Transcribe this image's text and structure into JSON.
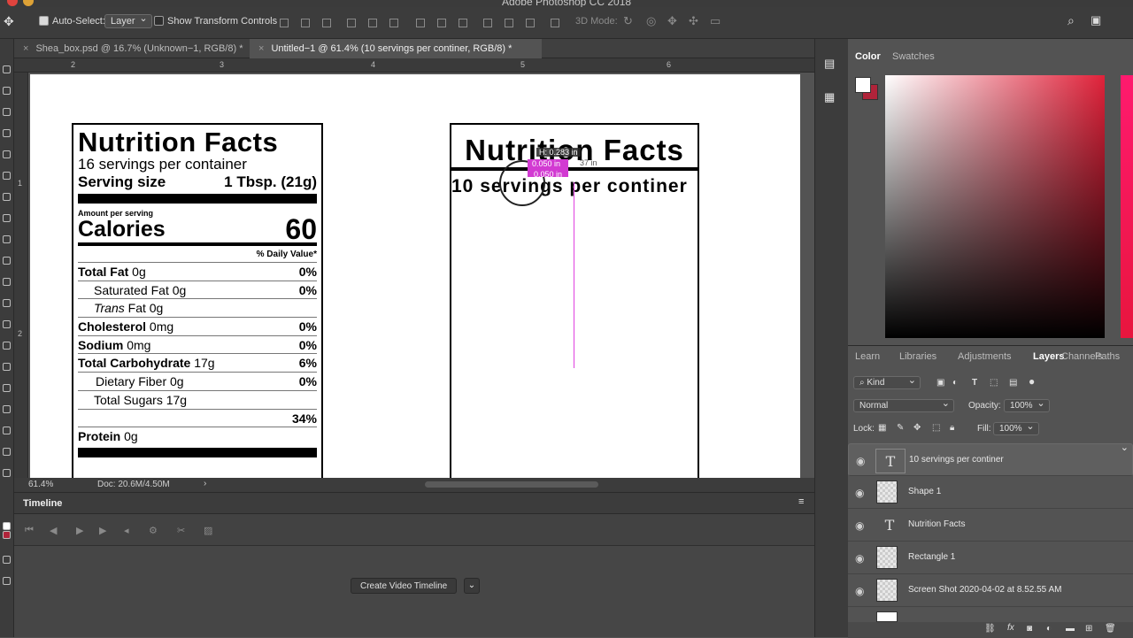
{
  "app": {
    "title": "Adobe Photoshop CC 2018"
  },
  "options_bar": {
    "auto_select_label": "Auto-Select:",
    "auto_select_value": "Layer",
    "transform_label": "Show Transform Controls",
    "mode_label": "3D Mode:"
  },
  "doc_tabs": [
    {
      "label": "Shea_box.psd @ 16.7% (Unknown−1, RGB/8) *"
    },
    {
      "label": "Untitled−1 @ 61.4% (10 servings per continer, RGB/8) *"
    }
  ],
  "rulers": {
    "top": [
      "2",
      "3",
      "4",
      "5",
      "6"
    ],
    "left": [
      "1",
      "2"
    ]
  },
  "nutrition_left": {
    "title": "Nutrition Facts",
    "servings": "16 servings per container",
    "serving_size_label": "Serving size",
    "serving_size_value": "1 Tbsp. (21g)",
    "amount_per_serving": "Amount per serving",
    "calories_label": "Calories",
    "calories_value": "60",
    "daily_value": "% Daily Value*",
    "rows": [
      {
        "bold": "Total Fat",
        "rest": " 0g",
        "pct": "0%"
      },
      {
        "bold": "",
        "rest": "Saturated Fat 0g",
        "pct": "0%"
      },
      {
        "bold": "",
        "italic": "Trans",
        "rest": " Fat 0g",
        "pct": ""
      },
      {
        "bold": "Cholesterol",
        "rest": " 0mg",
        "pct": "0%"
      },
      {
        "bold": "Sodium",
        "rest": " 0mg",
        "pct": "0%"
      },
      {
        "bold": "Total Carbohydrate",
        "rest": " 17g",
        "pct": "6%"
      },
      {
        "bold": "",
        "rest": "Dietary Fiber 0g",
        "pct": "0%"
      },
      {
        "bold": "",
        "rest": "Total Sugars 17g",
        "pct": ""
      },
      {
        "bold": "",
        "rest": "",
        "pct": "34%"
      },
      {
        "bold": "Protein",
        "rest": " 0g",
        "pct": ""
      }
    ]
  },
  "nutrition_right": {
    "title": "Nutrition Facts",
    "servings": "10 servings per continer"
  },
  "measure_hud": {
    "h": "H: 0.283 in",
    "a": "0.050 in",
    "b": "0.050 in",
    "c": "37 in"
  },
  "status": {
    "zoom": "61.4%",
    "doc": "Doc: 20.6M/4.50M"
  },
  "timeline": {
    "title": "Timeline",
    "create_button": "Create Video Timeline"
  },
  "color_panel": {
    "tabs": [
      "Color",
      "Swatches"
    ],
    "fg": "#ffffff",
    "bg": "#b0243a"
  },
  "layers_panel": {
    "tabs": [
      "Learn",
      "Libraries",
      "Adjustments",
      "Layers",
      "Channels",
      "Paths"
    ],
    "filter": "Kind",
    "blend_mode": "Normal",
    "opacity_label": "Opacity:",
    "opacity_value": "100%",
    "lock_label": "Lock:",
    "fill_label": "Fill:",
    "fill_value": "100%",
    "layers": [
      {
        "name": "10 servings per continer",
        "type": "text",
        "selected": true
      },
      {
        "name": "Shape 1",
        "type": "shape",
        "selected": false
      },
      {
        "name": "Nutrition Facts",
        "type": "text",
        "selected": false
      },
      {
        "name": "Rectangle 1",
        "type": "shape",
        "selected": false
      },
      {
        "name": "Screen Shot 2020-04-02 at 8.52.55 AM",
        "type": "image",
        "selected": false
      }
    ]
  }
}
